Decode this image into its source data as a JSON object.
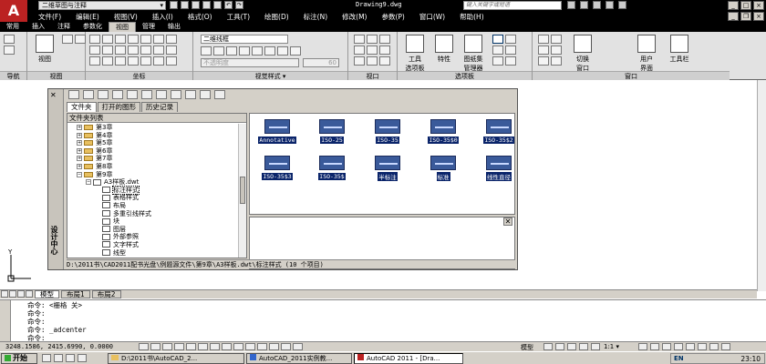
{
  "title_bar": {
    "workspace": "二维草图与注释",
    "doc_title": "Drawing9.dwg",
    "search_placeholder": "键入关键字或短语"
  },
  "menu": [
    "文件(F)",
    "编辑(E)",
    "视图(V)",
    "插入(I)",
    "格式(O)",
    "工具(T)",
    "绘图(D)",
    "标注(N)",
    "修改(M)",
    "参数(P)",
    "窗口(W)",
    "帮助(H)"
  ],
  "ribbon_tabs": [
    {
      "label": "常用",
      "active": false
    },
    {
      "label": "插入",
      "active": false
    },
    {
      "label": "注释",
      "active": false
    },
    {
      "label": "参数化",
      "active": false
    },
    {
      "label": "视图",
      "active": true
    },
    {
      "label": "管理",
      "active": false
    },
    {
      "label": "输出",
      "active": false
    }
  ],
  "ribbon": {
    "panels": [
      "导航",
      "视图",
      "坐标",
      "视觉样式 ▾",
      "视口",
      "选项板",
      "窗口"
    ],
    "view_btn": "视图",
    "visual_style": "二维线框",
    "disabled_select": "不透明度",
    "opacity_value": "60",
    "tool_palette": "工具\n选项板",
    "properties": "特性",
    "sheet_set": "图纸集\n管理器",
    "switch_window": "切换\n窗口",
    "user_interface": "用户\n界面",
    "toolbars": "工具栏"
  },
  "design_center": {
    "side_label": "设计中心",
    "tabs": [
      {
        "label": "文件夹",
        "active": true
      },
      {
        "label": "打开的图形",
        "active": false
      },
      {
        "label": "历史记录",
        "active": false
      }
    ],
    "tree_header": "文件夹列表",
    "tree": [
      {
        "label": "第3章",
        "type": "folder",
        "indent": 1
      },
      {
        "label": "第4章",
        "type": "folder",
        "indent": 1
      },
      {
        "label": "第5章",
        "type": "folder",
        "indent": 1
      },
      {
        "label": "第6章",
        "type": "folder",
        "indent": 1
      },
      {
        "label": "第7章",
        "type": "folder",
        "indent": 1
      },
      {
        "label": "第8章",
        "type": "folder",
        "indent": 1
      },
      {
        "label": "第9章",
        "type": "folder",
        "indent": 1
      },
      {
        "label": "A3样板.dwt",
        "type": "file",
        "indent": 2
      },
      {
        "label": "标注样式",
        "type": "item",
        "indent": 3,
        "selected": true
      },
      {
        "label": "表格样式",
        "type": "item",
        "indent": 3
      },
      {
        "label": "布局",
        "type": "item",
        "indent": 3
      },
      {
        "label": "多重引线样式",
        "type": "item",
        "indent": 3
      },
      {
        "label": "块",
        "type": "item",
        "indent": 3
      },
      {
        "label": "图层",
        "type": "item",
        "indent": 3
      },
      {
        "label": "外部参照",
        "type": "item",
        "indent": 3
      },
      {
        "label": "文字样式",
        "type": "item",
        "indent": 3
      },
      {
        "label": "线型",
        "type": "item",
        "indent": 3
      }
    ],
    "items": [
      "Annotative",
      "ISO-25",
      "ISO-35",
      "ISO-35$0",
      "ISO-35$2",
      "ISO-35$3",
      "ISO-35$",
      "半标注",
      "标准",
      "线性直径"
    ],
    "status": "D:\\2011书\\CAD2011配书光盘\\例题源文件\\第9章\\A3样板.dwt\\标注样式  (10 个项目)"
  },
  "layout_tabs": [
    {
      "label": "模型",
      "active": true
    },
    {
      "label": "布局1",
      "active": false
    },
    {
      "label": "布局2",
      "active": false
    }
  ],
  "command_lines": [
    "命令:  <栅格 关>",
    "命令:",
    "命令:",
    "命令:  _adcenter",
    "命令:"
  ],
  "status_bar": {
    "coords": "3248.1586, 2415.6990, 0.0000",
    "model": "模型",
    "scale": "1:1 ▾"
  },
  "taskbar": {
    "start": "开始",
    "tasks": [
      {
        "label": "D:\\2011书\\AutoCAD_2...",
        "active": false
      },
      {
        "label": "AutoCAD_2011实例教...",
        "active": false
      },
      {
        "label": "AutoCAD 2011 - [Dra...",
        "active": true
      }
    ],
    "lang": "EN",
    "clock": "23:10"
  }
}
